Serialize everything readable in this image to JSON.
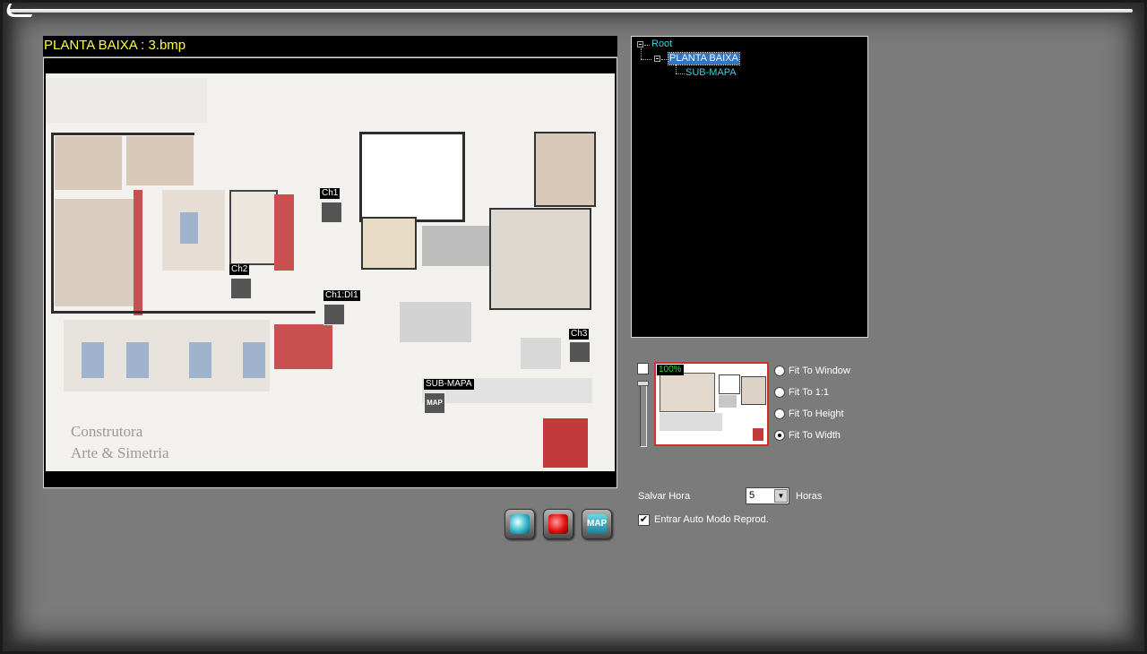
{
  "map": {
    "title": "PLANTA BAIXA : 3.bmp",
    "floorplan_caption_line1": "Construtora",
    "floorplan_caption_line2": "Arte & Simetria",
    "markers": [
      {
        "label": "Ch1",
        "kind": "camera"
      },
      {
        "label": "Ch2",
        "kind": "camera"
      },
      {
        "label": "Ch1:DI1",
        "kind": "alarm-input"
      },
      {
        "label": "Ch3",
        "kind": "camera"
      },
      {
        "label": "SUB-MAPA",
        "kind": "sub-map",
        "icon_text": "MAP"
      }
    ]
  },
  "toolbar": {
    "buttons": [
      {
        "icon": "camera-icon"
      },
      {
        "icon": "alarm-icon"
      },
      {
        "icon": "map-icon",
        "text": "MAP"
      }
    ]
  },
  "tree": {
    "root": "Root",
    "child": "PLANTA BAIXA",
    "grandchild": "SUB-MAPA"
  },
  "zoom": {
    "level": "100%",
    "options": [
      "Fit To Window",
      "Fit To 1:1",
      "Fit To Height",
      "Fit To Width"
    ],
    "selected": "Fit To Width"
  },
  "settings": {
    "save_label": "Salvar Hora",
    "hours_value": "5",
    "hours_label": "Horas",
    "auto_label": "Entrar Auto Modo Reprod.",
    "auto_checked": true
  },
  "colors": {
    "background": "#7b7b7b",
    "title_text": "#ffff3c",
    "tree_text": "#3ecfe0",
    "tree_selected": "#3275c2",
    "zoom_text": "#36d836",
    "preview_border": "#d23030"
  }
}
